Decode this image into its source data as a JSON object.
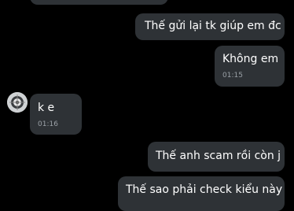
{
  "messages": [
    {
      "id": "m0",
      "side": "outgoing",
      "text": ""
    },
    {
      "id": "m1",
      "side": "outgoing",
      "text": "Thế gửi lại tk giúp em đc"
    },
    {
      "id": "m2",
      "side": "outgoing",
      "text": "Không em",
      "time": "01:15"
    },
    {
      "id": "m3",
      "side": "incoming",
      "text": "k e",
      "time": "01:16"
    },
    {
      "id": "m4",
      "side": "outgoing",
      "text": "Thế anh scam rồi còn j"
    },
    {
      "id": "m5",
      "side": "outgoing",
      "text": "Thế sao phải check kiểu này"
    }
  ],
  "colors": {
    "background": "#000000",
    "bubble": "#2e3236",
    "text": "#ffffff",
    "timestamp": "#9aa0a6"
  }
}
